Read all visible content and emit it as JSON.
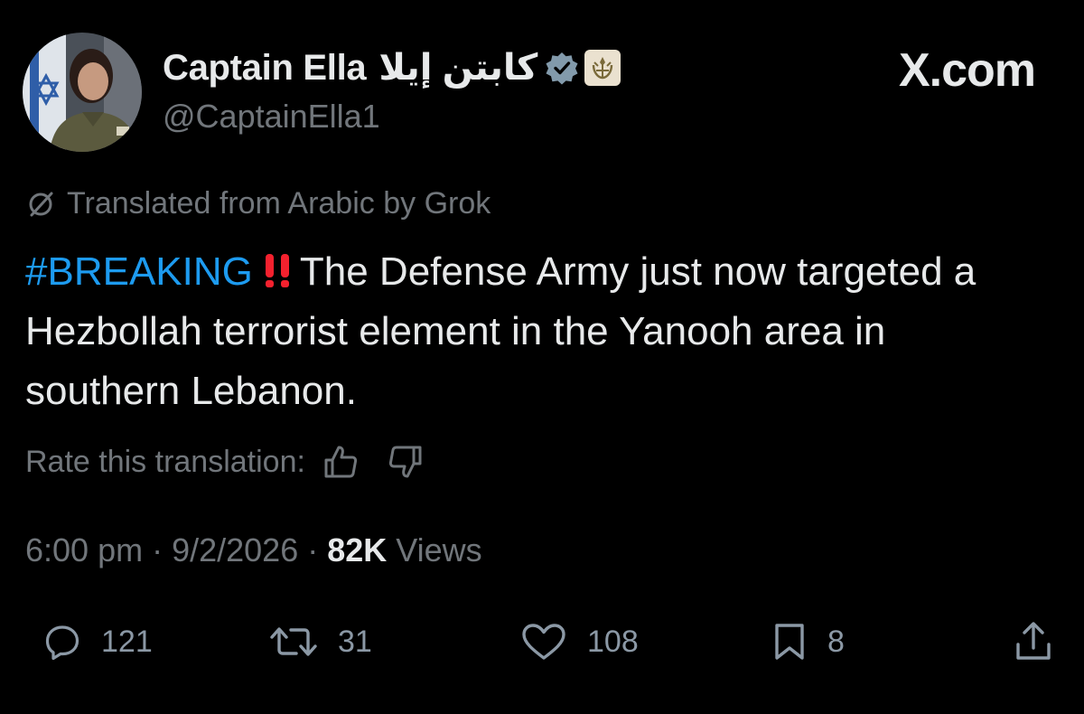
{
  "author": {
    "display_name": "Captain Ella",
    "display_name_ar": "كابتن إيلا",
    "handle": "@CaptainElla1",
    "verified_icon": "verified-badge-icon",
    "affiliate_icon": "idf-emblem-icon"
  },
  "brand": "X.com",
  "translation": {
    "notice": "Translated from Arabic by Grok",
    "rate_label": "Rate this translation:"
  },
  "tweet": {
    "hashtag": "#BREAKING",
    "text": "The Defense Army just now targeted a Hezbollah terrorist element in the Yanooh area in southern Lebanon."
  },
  "meta": {
    "time": "6:00 pm",
    "date": "9/2/2026",
    "views_count": "82K",
    "views_label": "Views"
  },
  "actions": {
    "replies": "121",
    "reposts": "31",
    "likes": "108",
    "bookmarks": "8"
  },
  "colors": {
    "background": "#000000",
    "text": "#e7e9ea",
    "secondary": "#71767b",
    "link": "#1d9bf0",
    "alert": "#f4212e",
    "verified": "#829aab"
  }
}
